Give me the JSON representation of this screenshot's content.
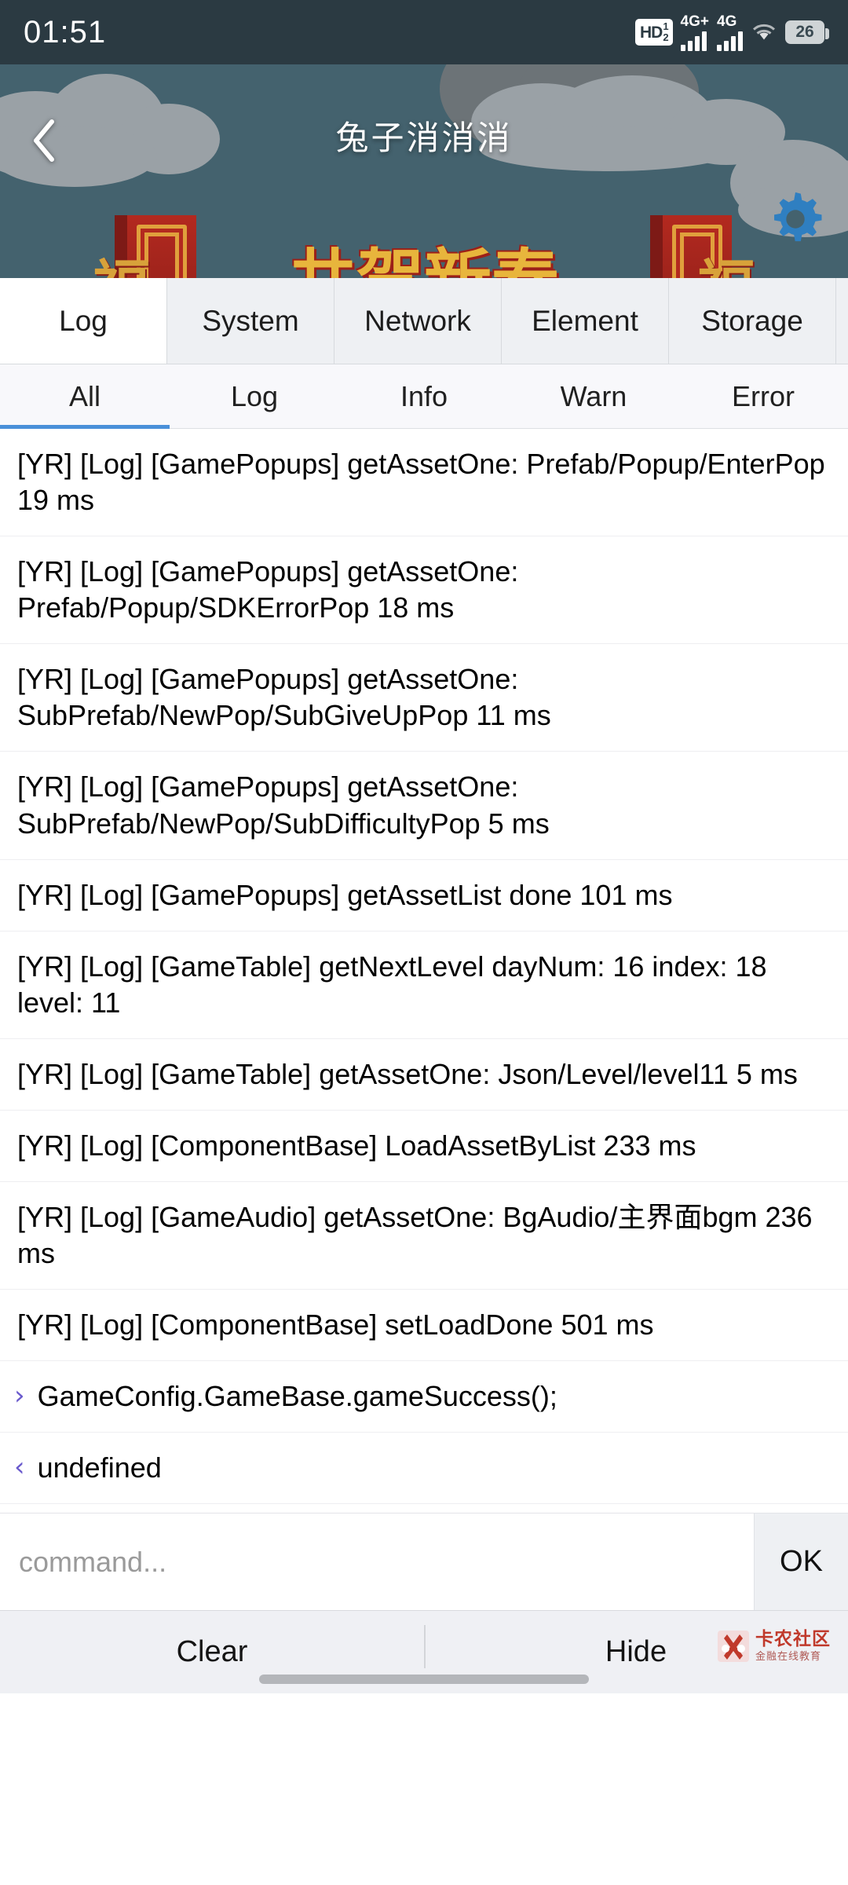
{
  "status_bar": {
    "time": "01:51",
    "hd_label": "HD",
    "hd_sim_top": "1",
    "hd_sim_bottom": "2",
    "sim1_network": "4G+",
    "sim2_network": "4G",
    "wifi_icon": "wifi-icon",
    "battery_level": "26"
  },
  "banner": {
    "back_icon": "back-chevron-icon",
    "title": "兔子消消消",
    "gear_icon": "gear-icon",
    "decor_left_fu": "福",
    "decor_right_fu": "福",
    "decor_center": "共贺新春",
    "bg_color": "#44626e"
  },
  "tabs": {
    "items": [
      {
        "label": "Log",
        "active": true
      },
      {
        "label": "System",
        "active": false
      },
      {
        "label": "Network",
        "active": false
      },
      {
        "label": "Element",
        "active": false
      },
      {
        "label": "Storage",
        "active": false
      }
    ]
  },
  "filters": {
    "items": [
      {
        "label": "All",
        "active": true
      },
      {
        "label": "Log",
        "active": false
      },
      {
        "label": "Info",
        "active": false
      },
      {
        "label": "Warn",
        "active": false
      },
      {
        "label": "Error",
        "active": false
      }
    ],
    "active_color": "#4a90d9"
  },
  "log_entries": [
    {
      "kind": "log",
      "text": "[YR] [Log] [GamePopups] getAssetOne: Prefab/Popup/EnterPop 19 ms"
    },
    {
      "kind": "log",
      "text": "[YR] [Log] [GamePopups] getAssetOne: Prefab/Popup/SDKErrorPop 18 ms"
    },
    {
      "kind": "log",
      "text": "[YR] [Log] [GamePopups] getAssetOne: SubPrefab/NewPop/SubGiveUpPop 11 ms"
    },
    {
      "kind": "log",
      "text": "[YR] [Log] [GamePopups] getAssetOne: SubPrefab/NewPop/SubDifficultyPop 5 ms"
    },
    {
      "kind": "log",
      "text": "[YR] [Log] [GamePopups] getAssetList done 101 ms"
    },
    {
      "kind": "log",
      "text": "[YR] [Log] [GameTable] getNextLevel dayNum: 16 index: 18 level: 11"
    },
    {
      "kind": "log",
      "text": "[YR] [Log] [GameTable] getAssetOne: Json/Level/level11 5 ms"
    },
    {
      "kind": "log",
      "text": "[YR] [Log] [ComponentBase] LoadAssetByList 233 ms"
    },
    {
      "kind": "log",
      "text": "[YR] [Log] [GameAudio] getAssetOne: BgAudio/主界面bgm 236 ms"
    },
    {
      "kind": "log",
      "text": "[YR] [Log] [ComponentBase] setLoadDone 501 ms"
    },
    {
      "kind": "command",
      "arrow": "›",
      "text": "GameConfig.GameBase.gameSuccess();"
    },
    {
      "kind": "result",
      "arrow": "‹",
      "text": "undefined"
    }
  ],
  "command_bar": {
    "placeholder": "command...",
    "value": "",
    "ok_label": "OK"
  },
  "bottom_bar": {
    "clear_label": "Clear",
    "hide_label": "Hide",
    "watermark_title": "卡农社区",
    "watermark_subtitle": "金融在线教育",
    "watermark_color": "#c0392b"
  }
}
